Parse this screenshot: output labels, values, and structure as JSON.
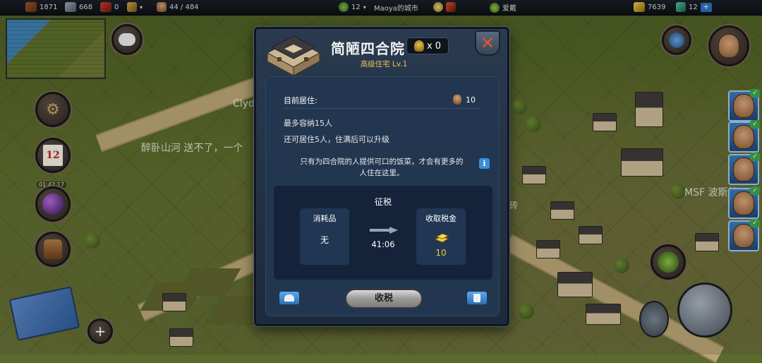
{
  "topbar": {
    "wood": "1871",
    "stone": "668",
    "food": "0",
    "population": "44 / 484",
    "level": "12",
    "city_name": "Maoya的城市",
    "player_name": "爱戴",
    "gold": "7639",
    "gems": "12",
    "add_label": "+"
  },
  "world": {
    "chat_1": "Clyde",
    "chat_2": "醉卧山河 送不了，一个",
    "chat_3": "MSF 波斯就两个",
    "chat_4": "砖",
    "calendar_day": "12",
    "timer_badge": "01:42:17"
  },
  "dialog": {
    "title": "简陋四合院",
    "worker_count": "x 0",
    "subtitle": "高级住宅 Lv.1",
    "residents_label": "目前居住:",
    "residents_value": "10",
    "capacity_text": "最多容纳15人",
    "remaining_text": "还可居住5人，住满后可以升级",
    "info_text": "只有为四合院的人提供可口的饭菜，才会有更多的人住在这里。",
    "info_icon": "i",
    "tax": {
      "title": "征税",
      "consumable_label": "消耗品",
      "consumable_value": "无",
      "timer": "41:06",
      "collect_label": "收取税金",
      "collect_value": "10"
    },
    "collect_button": "收税"
  },
  "colors": {
    "dialog_bg": "#233650",
    "subtitle": "#e7c356",
    "accent_blue": "#2e6fb3",
    "close_x": "#e45a2a"
  },
  "icons": [
    "wood-icon",
    "stone-icon",
    "food-icon",
    "population-icon",
    "level-icon",
    "gold-icon",
    "gem-icon",
    "close-icon",
    "info-icon",
    "arrow-right-icon",
    "gold-bar-icon",
    "storage-icon",
    "trash-icon",
    "chat-icon",
    "gear-icon",
    "calendar-icon",
    "bomb-icon",
    "bag-icon",
    "map-icon",
    "plus-icon",
    "hammer-icon",
    "shovel-icon"
  ]
}
